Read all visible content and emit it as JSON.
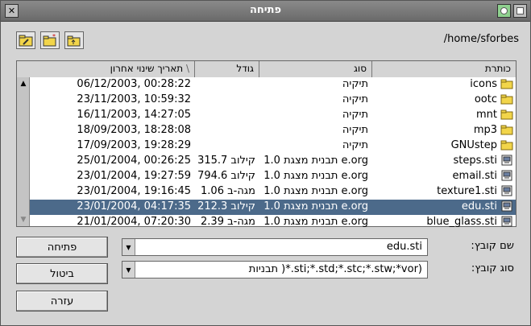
{
  "window": {
    "title": "פתיחה"
  },
  "toolbar": {
    "path": "/home/sforbes",
    "icons": [
      "go-home-icon",
      "new-folder-icon",
      "up-folder-icon"
    ]
  },
  "list": {
    "headers": {
      "name": "כותרת",
      "type": "סוג",
      "size": "גודל",
      "date": "תאריך שינוי אחרון"
    },
    "rows": [
      {
        "name": "icons",
        "type": "תיקיה",
        "size": "",
        "date": "06/12/2003, 00:28:22",
        "kind": "folder"
      },
      {
        "name": "ootc",
        "type": "תיקיה",
        "size": "",
        "date": "23/11/2003, 10:59:32",
        "kind": "folder"
      },
      {
        "name": "mnt",
        "type": "תיקיה",
        "size": "",
        "date": "16/11/2003, 14:27:05",
        "kind": "folder"
      },
      {
        "name": "mp3",
        "type": "תיקיה",
        "size": "",
        "date": "18/09/2003, 18:28:08",
        "kind": "folder"
      },
      {
        "name": "GNUstep",
        "type": "תיקיה",
        "size": "",
        "date": "17/09/2003, 19:28:29",
        "kind": "folder"
      },
      {
        "name": "steps.sti",
        "type": "תבנית מצגת 1.0 e.org",
        "size": "315.7 קילוב",
        "date": "25/01/2004, 00:26:25",
        "kind": "file"
      },
      {
        "name": "email.sti",
        "type": "תבנית מצגת 1.0 e.org",
        "size": "794.6 קילוב",
        "date": "23/01/2004, 19:27:59",
        "kind": "file"
      },
      {
        "name": "texture1.sti",
        "type": "תבנית מצגת 1.0 e.org",
        "size": "1.06 מגה-ב",
        "date": "23/01/2004, 19:16:45",
        "kind": "file"
      },
      {
        "name": "edu.sti",
        "type": "תבנית מצגת 1.0 e.org",
        "size": "212.3 קילוב",
        "date": "23/01/2004, 04:17:35",
        "kind": "file",
        "selected": true
      },
      {
        "name": "blue_glass.sti",
        "type": "תבנית מצגת 1.0 e.org",
        "size": "2.39 מגה-ב",
        "date": "21/01/2004, 07:20:30",
        "kind": "file"
      }
    ]
  },
  "form": {
    "filename_label": "שם קובץ:",
    "filename_value": "edu.sti",
    "filetype_label": "סוג קובץ:",
    "filetype_value": "תבניות )*.sti;*.std;*.stc;*.stw;*vor)"
  },
  "buttons": {
    "open": "פתיחה",
    "cancel": "ביטול",
    "help": "עזרה"
  },
  "colors": {
    "selection": "#4c6a8a",
    "folder": "#f2d54a"
  }
}
